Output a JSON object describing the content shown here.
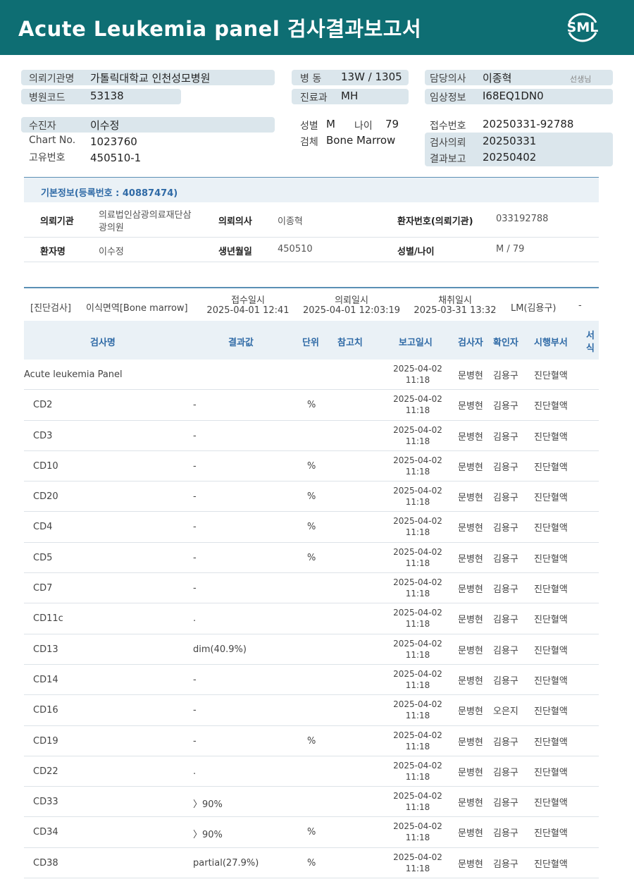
{
  "header": {
    "title": "Acute  Leukemia  panel 검사결과보고서",
    "logo_text": "SML"
  },
  "info": {
    "requesting_institution_label": "의뢰기관명",
    "requesting_institution": "가톨릭대학교 인천성모병원",
    "hospital_code_label": "병원코드",
    "hospital_code": "53138",
    "ward_label": "병  동",
    "ward": "13W / 1305",
    "department_label": "진료과",
    "department": "MH",
    "physician_label": "담당의사",
    "physician": "이종혁",
    "physician_suffix": "선생님",
    "clinical_label": "임상정보",
    "clinical": "I68EQ1DN0",
    "patient_label": "수진자",
    "patient": "이수정",
    "chart_label": "Chart No.",
    "chart": "1023760",
    "unique_label": "고유번호",
    "unique": "450510-1",
    "sex_label": "성별",
    "sex": "M",
    "age_label": "나이",
    "age": "79",
    "specimen_label": "검체",
    "specimen": "Bone Marrow",
    "receipt_label": "접수번호",
    "receipt": "20250331-92788",
    "request_label": "검사의뢰",
    "request": "20250331",
    "report_label": "결과보고",
    "report": "20250402"
  },
  "basic": {
    "heading": "기본정보(등록번호 : 40887474)",
    "inst_label": "의뢰기관",
    "inst_line1": "의료법인삼광의료재단삼",
    "inst_line2": "광의원",
    "doctor_label": "의뢰의사",
    "doctor": "이종혁",
    "patient_no_label": "환자번호(의뢰기관)",
    "patient_no": "033192788",
    "name_label": "환자명",
    "name": "이수정",
    "dob_label": "생년월일",
    "dob": "450510",
    "sexage_label": "성별/나이",
    "sexage": "M / 79"
  },
  "exam": {
    "category": "[진단검사]",
    "type": "이식면역[Bone marrow]",
    "received_label": "접수일시",
    "received": "2025-04-01 12:41",
    "requested_label": "의뢰일시",
    "requested": "2025-04-01 12:03:19",
    "collected_label": "채취일시",
    "collected": "2025-03-31 13:32",
    "lm": "LM(김용구)",
    "dash": "-"
  },
  "table": {
    "headers": {
      "name": "검사명",
      "result": "결과값",
      "unit": "단위",
      "ref": "참고치",
      "report_time": "보고일시",
      "tester": "검사자",
      "confirmer": "확인자",
      "dept": "시행부서",
      "form_1": "서",
      "form_2": "식"
    },
    "rows": [
      {
        "name": "Acute leukemia Panel",
        "result": "",
        "unit": "",
        "date": "2025-04-02",
        "time": "11:18",
        "tester": "문병현",
        "confirmer": "김용구",
        "dept": "진단혈액"
      },
      {
        "name": "CD2",
        "result": "-",
        "unit": "%",
        "date": "2025-04-02",
        "time": "11:18",
        "tester": "문병현",
        "confirmer": "김용구",
        "dept": "진단혈액"
      },
      {
        "name": "CD3",
        "result": "-",
        "unit": "",
        "date": "2025-04-02",
        "time": "11:18",
        "tester": "문병현",
        "confirmer": "김용구",
        "dept": "진단혈액"
      },
      {
        "name": "CD10",
        "result": "-",
        "unit": "%",
        "date": "2025-04-02",
        "time": "11:18",
        "tester": "문병현",
        "confirmer": "김용구",
        "dept": "진단혈액"
      },
      {
        "name": "CD20",
        "result": "-",
        "unit": "%",
        "date": "2025-04-02",
        "time": "11:18",
        "tester": "문병현",
        "confirmer": "김용구",
        "dept": "진단혈액"
      },
      {
        "name": "CD4",
        "result": "-",
        "unit": "%",
        "date": "2025-04-02",
        "time": "11:18",
        "tester": "문병현",
        "confirmer": "김용구",
        "dept": "진단혈액"
      },
      {
        "name": "CD5",
        "result": "-",
        "unit": "%",
        "date": "2025-04-02",
        "time": "11:18",
        "tester": "문병현",
        "confirmer": "김용구",
        "dept": "진단혈액"
      },
      {
        "name": "CD7",
        "result": "-",
        "unit": "",
        "date": "2025-04-02",
        "time": "11:18",
        "tester": "문병현",
        "confirmer": "김용구",
        "dept": "진단혈액"
      },
      {
        "name": "CD11c",
        "result": ".",
        "unit": "",
        "date": "2025-04-02",
        "time": "11:18",
        "tester": "문병현",
        "confirmer": "김용구",
        "dept": "진단혈액"
      },
      {
        "name": "CD13",
        "result": "dim(40.9%)",
        "unit": "",
        "date": "2025-04-02",
        "time": "11:18",
        "tester": "문병현",
        "confirmer": "김용구",
        "dept": "진단혈액"
      },
      {
        "name": "CD14",
        "result": "-",
        "unit": "",
        "date": "2025-04-02",
        "time": "11:18",
        "tester": "문병현",
        "confirmer": "김용구",
        "dept": "진단혈액"
      },
      {
        "name": "CD16",
        "result": "-",
        "unit": "",
        "date": "2025-04-02",
        "time": "11:18",
        "tester": "문병현",
        "confirmer": "오은지",
        "dept": "진단혈액"
      },
      {
        "name": "CD19",
        "result": "-",
        "unit": "%",
        "date": "2025-04-02",
        "time": "11:18",
        "tester": "문병현",
        "confirmer": "김용구",
        "dept": "진단혈액"
      },
      {
        "name": "CD22",
        "result": ".",
        "unit": "",
        "date": "2025-04-02",
        "time": "11:18",
        "tester": "문병현",
        "confirmer": "김용구",
        "dept": "진단혈액"
      },
      {
        "name": "CD33",
        "result": "〉90%",
        "unit": "",
        "date": "2025-04-02",
        "time": "11:18",
        "tester": "문병현",
        "confirmer": "김용구",
        "dept": "진단혈액"
      },
      {
        "name": "CD34",
        "result": "〉90%",
        "unit": "%",
        "date": "2025-04-02",
        "time": "11:18",
        "tester": "문병현",
        "confirmer": "김용구",
        "dept": "진단혈액"
      },
      {
        "name": "CD38",
        "result": "partial(27.9%)",
        "unit": "%",
        "date": "2025-04-02",
        "time": "11:18",
        "tester": "문병현",
        "confirmer": "김용구",
        "dept": "진단혈액"
      }
    ]
  }
}
